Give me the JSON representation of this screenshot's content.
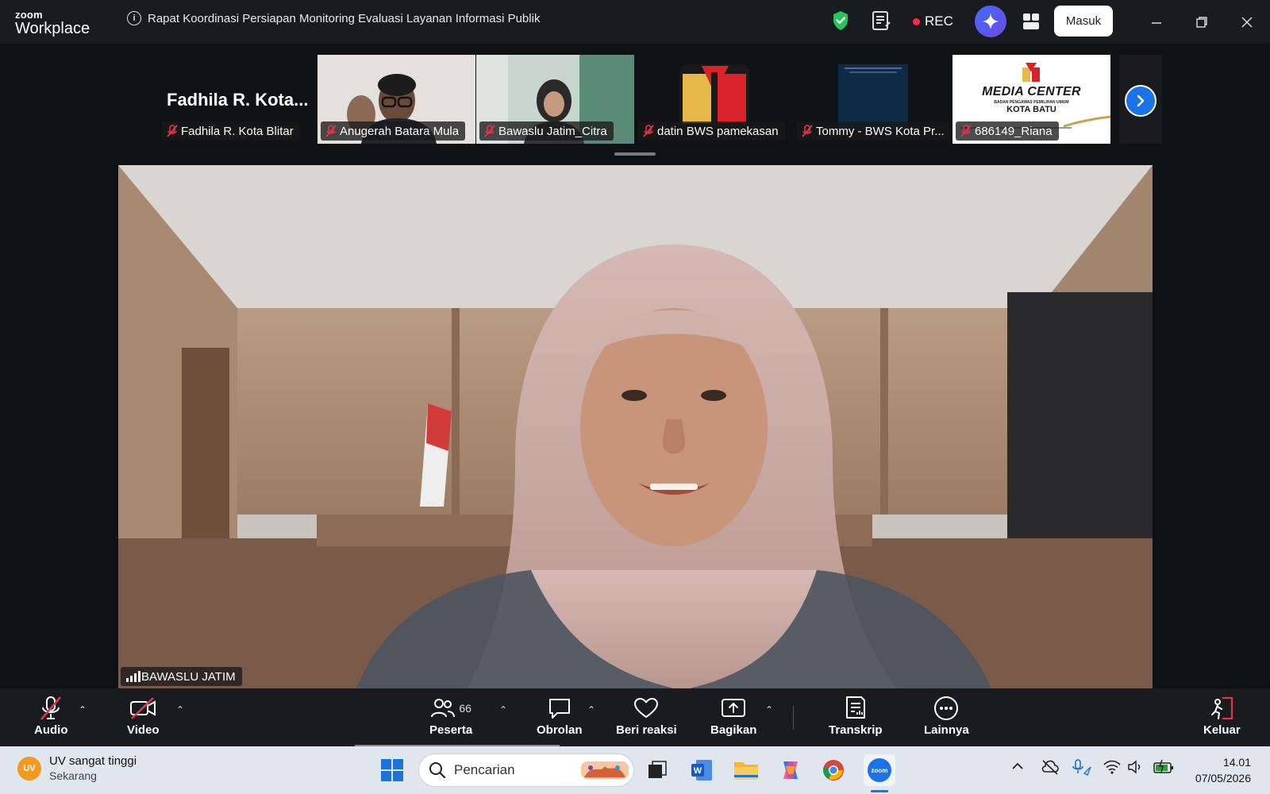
{
  "titlebar": {
    "brand_top": "zoom",
    "brand_bottom": "Workplace",
    "meeting_title": "Rapat Koordinasi Persiapan Monitoring Evaluasi Layanan Informasi Publik",
    "rec_label": "REC",
    "signin_label": "Masuk"
  },
  "gallery": {
    "self_name": "Fadhila R. Kota...",
    "tiles": [
      {
        "label": "Fadhila R. Kota Blitar"
      },
      {
        "label": "Anugerah Batara Mula"
      },
      {
        "label": "Bawaslu Jatim_Citra"
      },
      {
        "label": "datin BWS pamekasan"
      },
      {
        "label": "Tommy - BWS Kota Pr..."
      },
      {
        "label": "686149_Riana"
      }
    ],
    "media_center_title": "MEDIA CENTER",
    "media_center_sub": "BADAN PENGAWAS PEMILIHAN UMUM",
    "media_center_city": "KOTA BATU"
  },
  "main_video": {
    "speaker_label": "BAWASLU JATIM"
  },
  "toolbar": {
    "audio": "Audio",
    "video": "Video",
    "participants": "Peserta",
    "participant_count": "66",
    "chat": "Obrolan",
    "react": "Beri reaksi",
    "share": "Bagikan",
    "transcript": "Transkrip",
    "more": "Lainnya",
    "leave": "Keluar"
  },
  "taskbar": {
    "weather_badge": "UV",
    "weather_title": "UV sangat tinggi",
    "weather_sub": "Sekarang",
    "search_placeholder": "Pencarian",
    "zoom_app_label": "zoom",
    "time": "14.01",
    "date": "07/05/2026"
  },
  "colors": {
    "accent_blue": "#1a73e8",
    "rec_red": "#ff2a44",
    "shield_green": "#22c55e",
    "mic_off_red": "#e0354a"
  }
}
